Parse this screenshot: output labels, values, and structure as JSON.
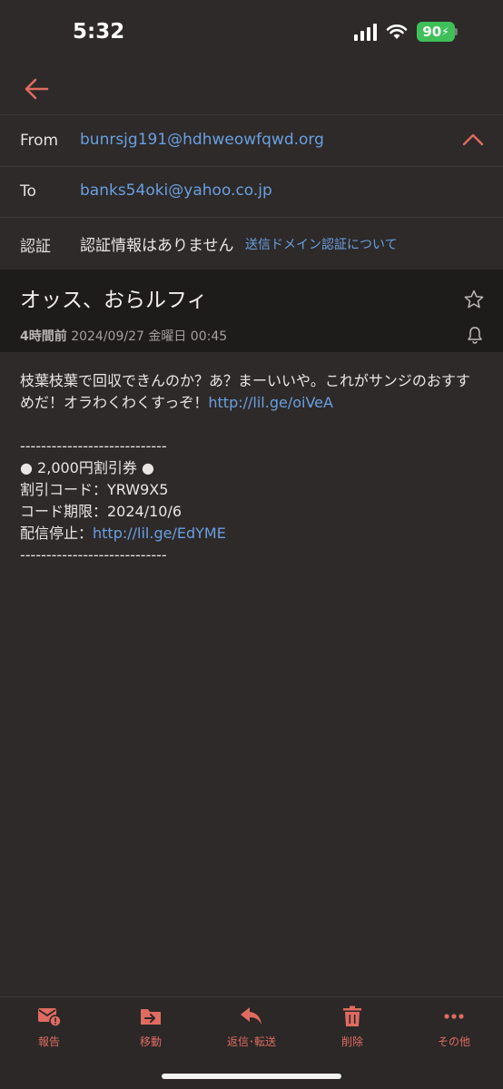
{
  "status": {
    "time": "5:32",
    "battery": "90"
  },
  "header": {
    "from_label": "From",
    "from_value": "bunrsjg191@hdhweowfqwd.org",
    "to_label": "To",
    "to_value": "banks54oki@yahoo.co.jp",
    "auth_label": "認証",
    "auth_value": "認証情報はありません",
    "auth_link": "送信ドメイン認証について"
  },
  "subject": "オッス、おらルフィ",
  "meta": {
    "relative": "4時間前",
    "datetime": "2024/09/27 金曜日 00:45"
  },
  "body": {
    "line1": "枝葉枝葉で回収できんのか？あ？まーいいや。これがサンジのおすすめだ！オラわくわくすっぞ！",
    "link1": "http://lil.ge/oiVeA",
    "divider": "----------------------------",
    "coupon": "● 2,000円割引券 ●",
    "code": "割引コード：YRW9X5",
    "expiry": "コード期限：2024/10/6",
    "unsubscribe_label": "配信停止：",
    "link2": "http://lil.ge/EdYME"
  },
  "toolbar": {
    "report": "報告",
    "move": "移動",
    "reply": "返信･転送",
    "delete": "削除",
    "more": "その他"
  },
  "colors": {
    "accent": "#df6b61",
    "link": "#6b9fe0",
    "background": "#2d2a29"
  }
}
